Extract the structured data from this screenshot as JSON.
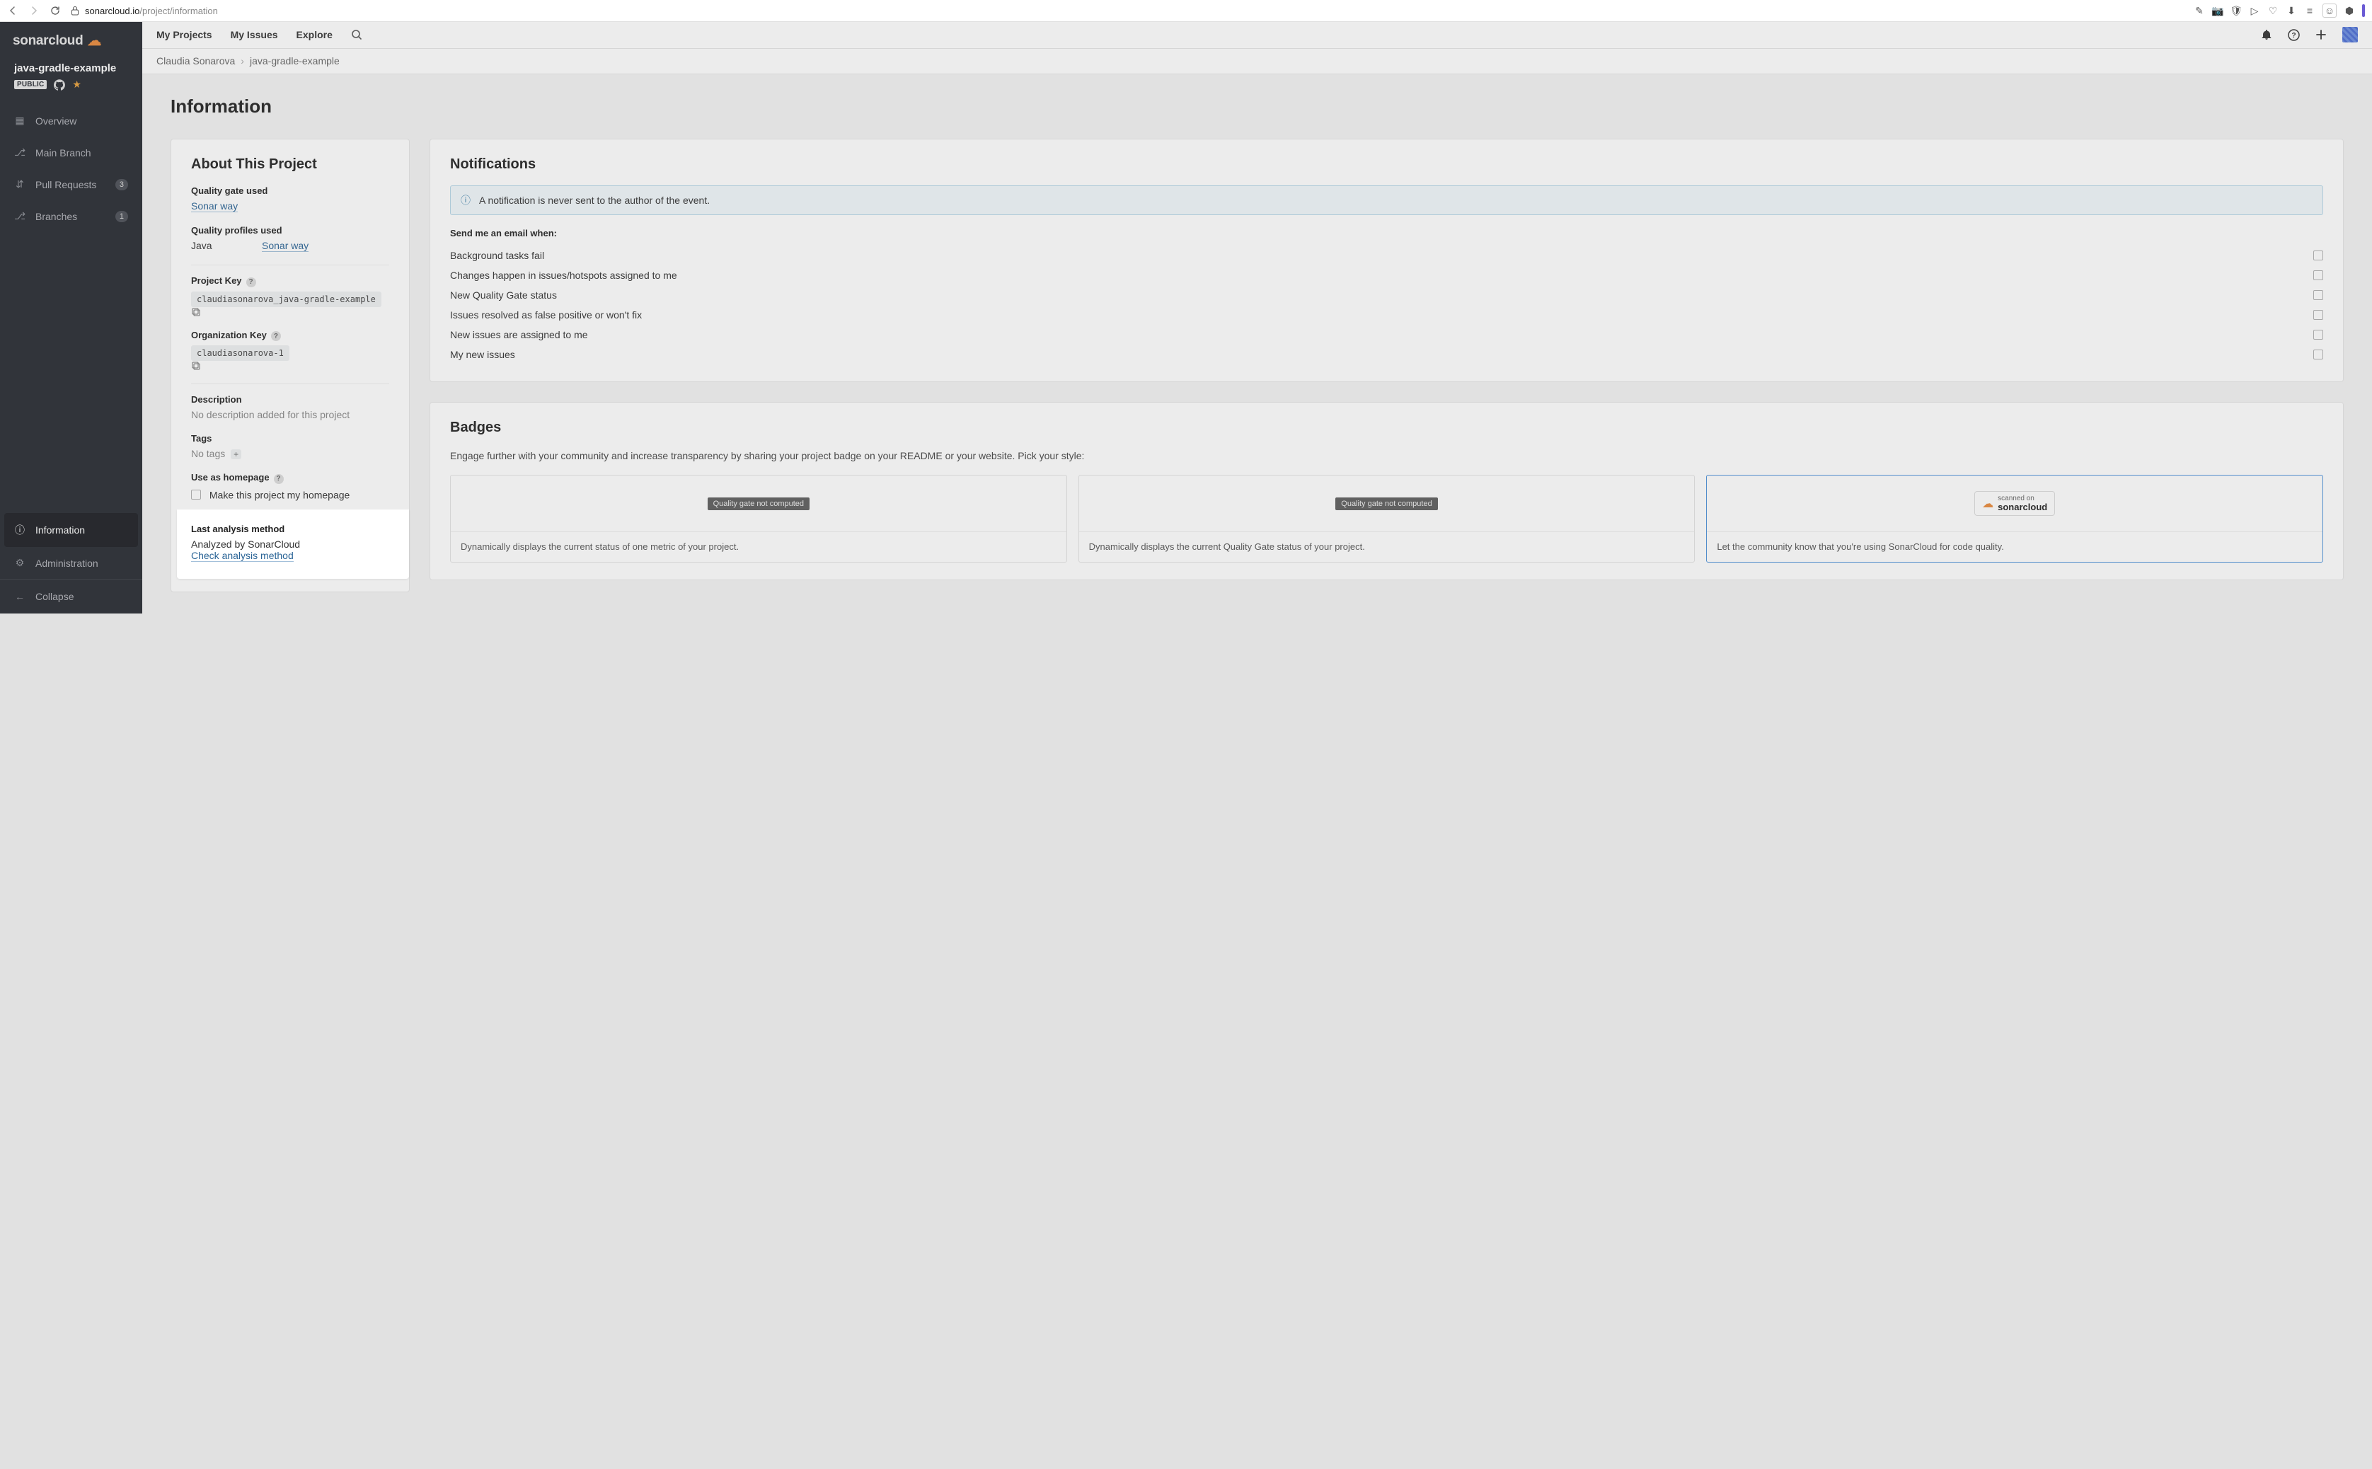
{
  "browser": {
    "url_host": "sonarcloud.io",
    "url_path": "/project/information"
  },
  "brand": {
    "name": "sonarcloud"
  },
  "project": {
    "name": "java-gradle-example",
    "visibility": "PUBLIC"
  },
  "sidebar": {
    "items": [
      {
        "label": "Overview"
      },
      {
        "label": "Main Branch"
      },
      {
        "label": "Pull Requests",
        "count": "3"
      },
      {
        "label": "Branches",
        "count": "1"
      },
      {
        "label": "Information"
      },
      {
        "label": "Administration"
      }
    ],
    "collapse": "Collapse"
  },
  "topnav": {
    "items": [
      "My Projects",
      "My Issues",
      "Explore"
    ]
  },
  "breadcrumbs": {
    "org": "Claudia Sonarova",
    "project": "java-gradle-example"
  },
  "page": {
    "title": "Information"
  },
  "about": {
    "heading": "About This Project",
    "quality_gate_label": "Quality gate used",
    "quality_gate_value": "Sonar way",
    "quality_profiles_label": "Quality profiles used",
    "qp_lang": "Java",
    "qp_profile": "Sonar way",
    "project_key_label": "Project Key",
    "project_key_value": "claudiasonarova_java-gradle-example",
    "org_key_label": "Organization Key",
    "org_key_value": "claudiasonarova-1",
    "description_label": "Description",
    "description_value": "No description added for this project",
    "tags_label": "Tags",
    "tags_value": "No tags",
    "homepage_label": "Use as homepage",
    "homepage_checkbox": "Make this project my homepage",
    "last_analysis_label": "Last analysis method",
    "last_analysis_prefix": "Analyzed by SonarCloud ",
    "last_analysis_link": "Check analysis method"
  },
  "notifications": {
    "heading": "Notifications",
    "banner": "A notification is never sent to the author of the event.",
    "send_label": "Send me an email when:",
    "items": [
      "Background tasks fail",
      "Changes happen in issues/hotspots assigned to me",
      "New Quality Gate status",
      "Issues resolved as false positive or won't fix",
      "New issues are assigned to me",
      "My new issues"
    ]
  },
  "badges": {
    "heading": "Badges",
    "desc": "Engage further with your community and increase transparency by sharing your project badge on your README or your website. Pick your style:",
    "cards": [
      {
        "chip": "Quality gate not computed",
        "caption": "Dynamically displays the current status of one metric of your project."
      },
      {
        "chip": "Quality gate not computed",
        "caption": "Dynamically displays the current Quality Gate status of your project."
      },
      {
        "scanned_top": "scanned on",
        "scanned_brand": "sonarcloud",
        "caption": "Let the community know that you're using SonarCloud for code quality."
      }
    ]
  }
}
